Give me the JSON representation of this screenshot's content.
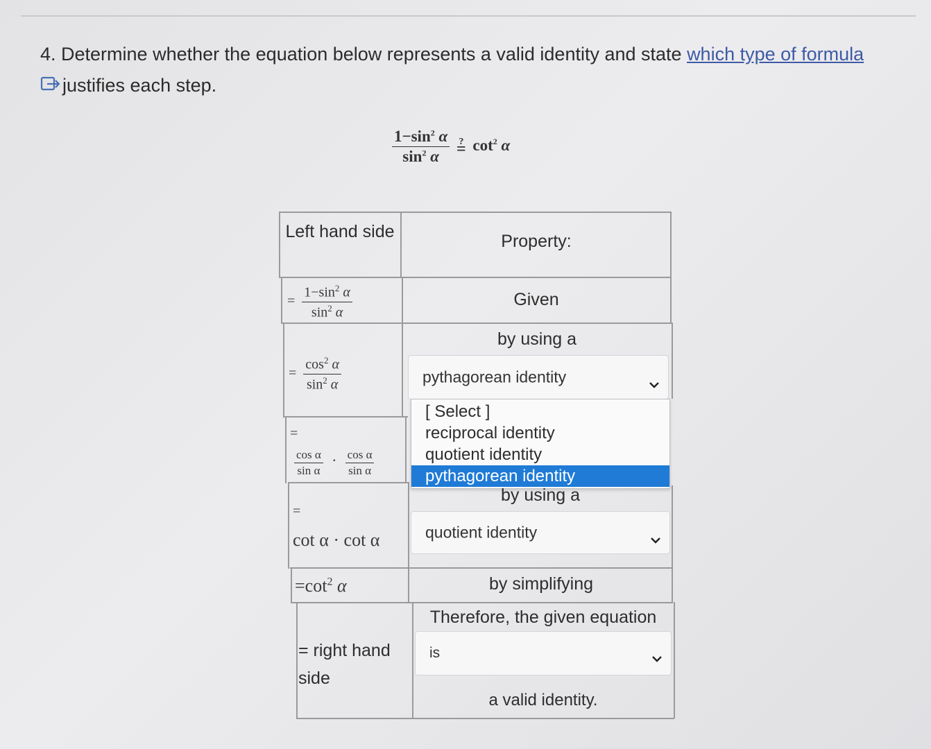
{
  "question": {
    "prefix": "4. Determine whether the equation below represents a valid identity and state ",
    "link_text": "which type of formula",
    "line2": "justifies each step."
  },
  "main_equation": {
    "num_1": "1",
    "num_sin": "sin",
    "den_sin": "sin",
    "power": "2",
    "alpha": "α",
    "question_mark": "?",
    "equals": "=",
    "rhs_cot": "cot"
  },
  "table": {
    "header_left": "Left hand side",
    "header_right": "Property:",
    "row1": {
      "eq": "=",
      "num": "1−sin",
      "den": "sin",
      "power": "2",
      "alpha": "α",
      "property": "Given"
    },
    "row2": {
      "eq": "=",
      "num": "cos",
      "den": "sin",
      "power": "2",
      "alpha": "α",
      "label": "by using a",
      "select_value": "pythagorean identity"
    },
    "row3": {
      "eq": "=",
      "num": "cos α",
      "den": "sin α",
      "dot": "·",
      "label": "by using a"
    },
    "row4": {
      "eq": "=",
      "expr": "cot α · cot α",
      "select_value": "quotient identity"
    },
    "row5": {
      "expr": "=cot",
      "power": "2",
      "alpha": "α",
      "property": "by simplifying"
    },
    "row6": {
      "left_text": "= right hand side",
      "label": "Therefore, the given equation",
      "select_value": "is",
      "tail": "a valid identity."
    }
  },
  "dropdown": {
    "options": [
      "[ Select ]",
      "reciprocal identity",
      "quotient identity",
      "pythagorean identity"
    ],
    "selected_index": 3,
    "selected_color": "#1f7bd6"
  },
  "icons": {
    "external": "external-link-icon",
    "chevron": "chevron-down-icon"
  }
}
